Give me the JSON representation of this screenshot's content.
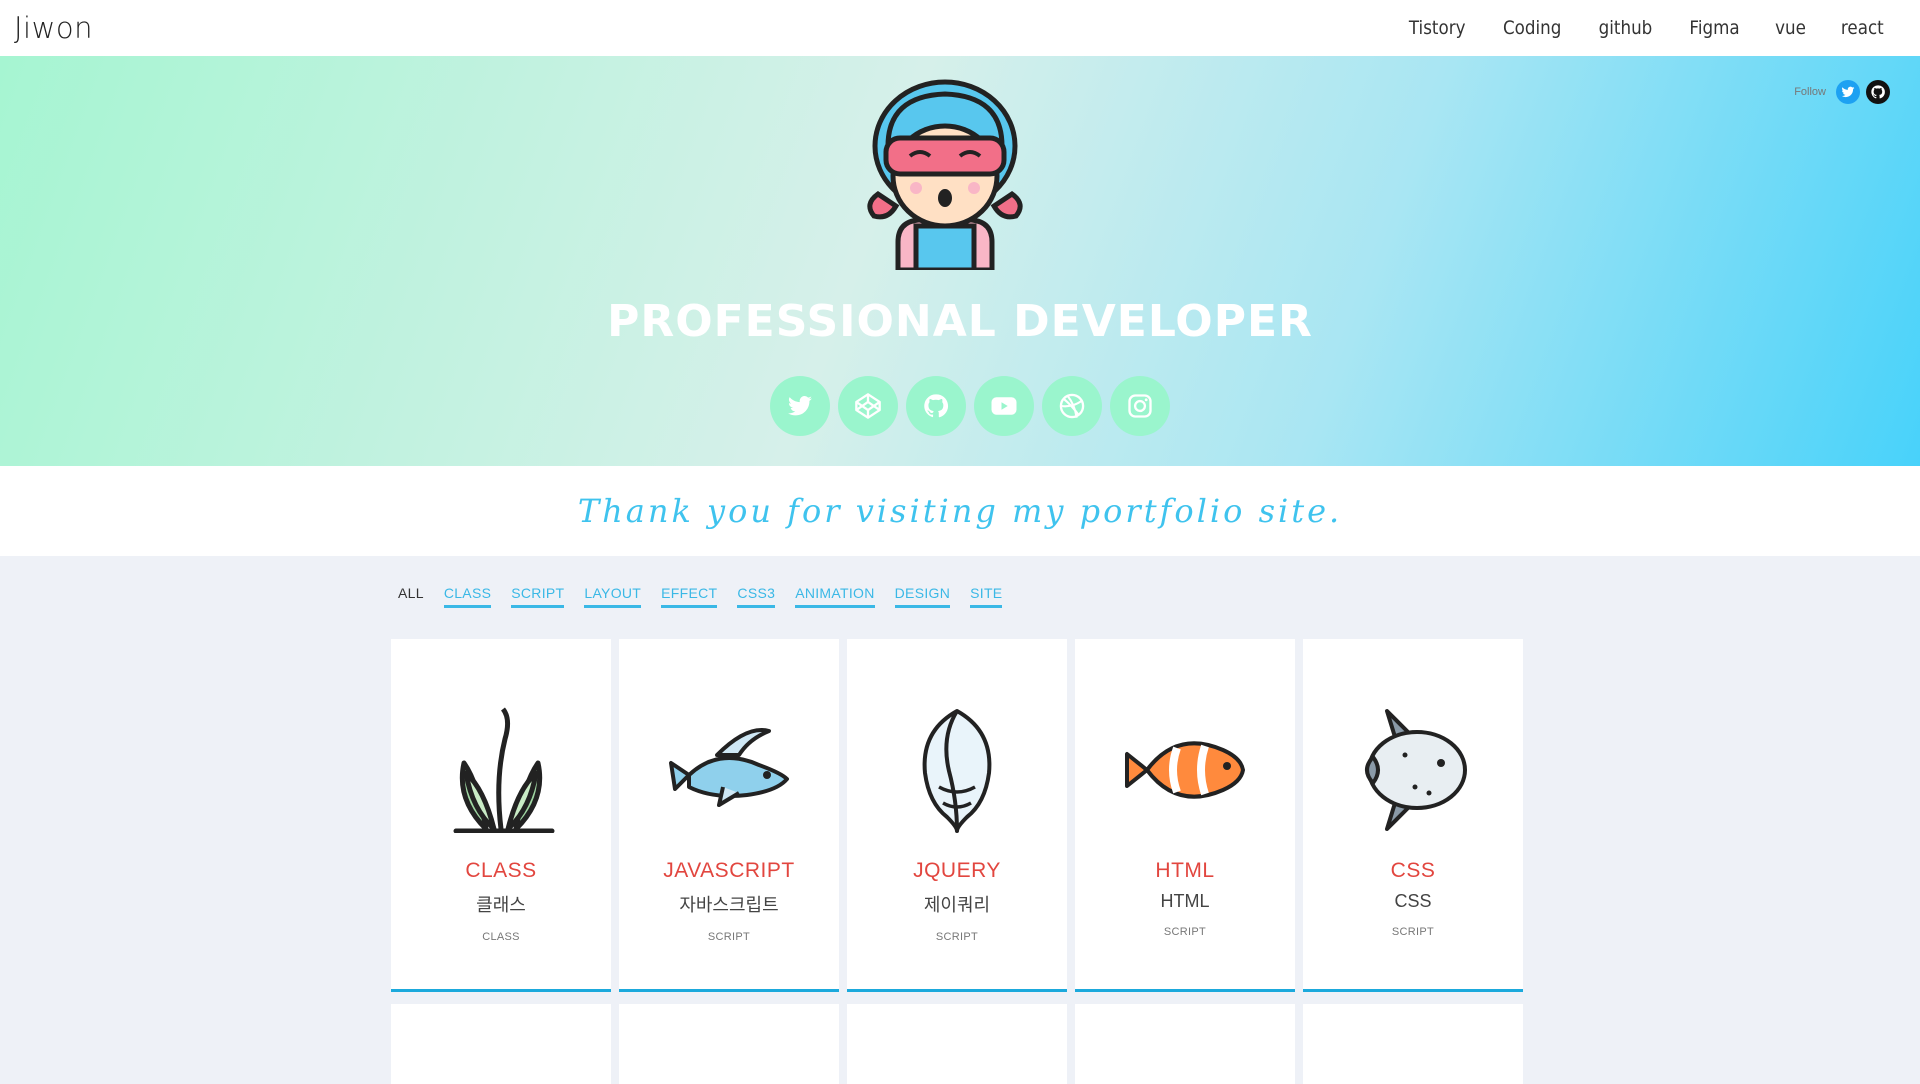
{
  "header": {
    "logo": "Jiwon",
    "nav": [
      "Tistory",
      "Coding",
      "github",
      "Figma",
      "vue",
      "react"
    ]
  },
  "hero": {
    "follow_label": "Follow",
    "follow_icons": [
      "twitter-icon",
      "github-icon"
    ],
    "title": "PROFESSIONAL DEVELOPER",
    "socials": [
      "twitter-icon",
      "codepen-icon",
      "github-icon",
      "youtube-icon",
      "dribbble-icon",
      "instagram-icon"
    ],
    "social_color": "#9af5cd"
  },
  "thanks": "Thank you for visiting my portfolio site.",
  "filters": [
    "ALL",
    "CLASS",
    "SCRIPT",
    "LAYOUT",
    "EFFECT",
    "CSS3",
    "ANIMATION",
    "DESIGN",
    "SITE"
  ],
  "cards": [
    {
      "title": "CLASS",
      "sub": "클래스",
      "tag": "CLASS",
      "icon": "seaweed-icon"
    },
    {
      "title": "JAVASCRIPT",
      "sub": "자바스크립트",
      "tag": "SCRIPT",
      "icon": "flying-fish-icon"
    },
    {
      "title": "JQUERY",
      "sub": "제이쿼리",
      "tag": "SCRIPT",
      "icon": "shell-icon"
    },
    {
      "title": "HTML",
      "sub": "HTML",
      "tag": "SCRIPT",
      "icon": "clownfish-icon"
    },
    {
      "title": "CSS",
      "sub": "CSS",
      "tag": "SCRIPT",
      "icon": "sunfish-icon"
    }
  ],
  "colors": {
    "accent": "#1ba9dc",
    "title_red": "#e2463f",
    "filter_blue": "#3ab8e6"
  }
}
